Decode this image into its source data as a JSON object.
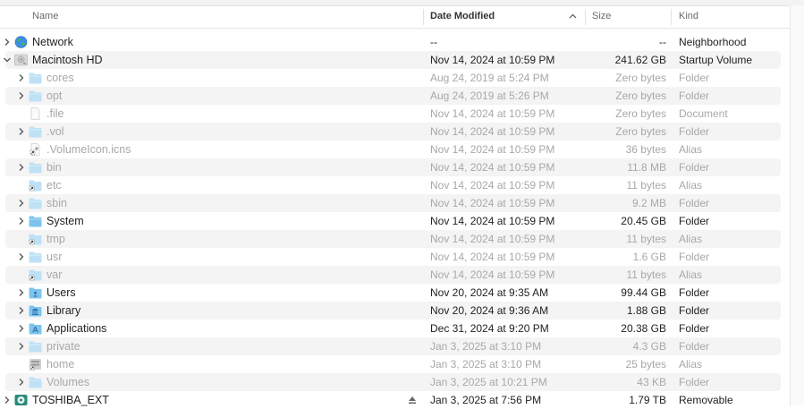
{
  "columns": {
    "name": "Name",
    "date": "Date Modified",
    "size": "Size",
    "kind": "Kind"
  },
  "rows": [
    {
      "level": 0,
      "disclosure": "collapsed",
      "icon": "network-globe-icon",
      "name": "Network",
      "date": "--",
      "size": "--",
      "kind": "Neighborhood",
      "dimmed": false,
      "stripe": false
    },
    {
      "level": 0,
      "disclosure": "expanded",
      "icon": "hard-drive-icon",
      "name": "Macintosh HD",
      "date": "Nov 14, 2024 at 10:59 PM",
      "size": "241.62 GB",
      "kind": "Startup Volume",
      "dimmed": false,
      "stripe": true
    },
    {
      "level": 1,
      "disclosure": "collapsed",
      "icon": "folder-icon",
      "name": "cores",
      "date": "Aug 24, 2019 at 5:24 PM",
      "size": "Zero bytes",
      "kind": "Folder",
      "dimmed": true,
      "stripe": false
    },
    {
      "level": 1,
      "disclosure": "collapsed",
      "icon": "folder-icon",
      "name": "opt",
      "date": "Aug 24, 2019 at 5:26 PM",
      "size": "Zero bytes",
      "kind": "Folder",
      "dimmed": true,
      "stripe": true
    },
    {
      "level": 1,
      "disclosure": "none",
      "icon": "document-icon",
      "name": ".file",
      "date": "Nov 14, 2024 at 10:59 PM",
      "size": "Zero bytes",
      "kind": "Document",
      "dimmed": true,
      "stripe": false
    },
    {
      "level": 1,
      "disclosure": "collapsed",
      "icon": "folder-icon",
      "name": ".vol",
      "date": "Nov 14, 2024 at 10:59 PM",
      "size": "Zero bytes",
      "kind": "Folder",
      "dimmed": true,
      "stripe": true
    },
    {
      "level": 1,
      "disclosure": "none",
      "icon": "alias-document-icon",
      "name": ".VolumeIcon.icns",
      "date": "Nov 14, 2024 at 10:59 PM",
      "size": "36 bytes",
      "kind": "Alias",
      "dimmed": true,
      "stripe": false
    },
    {
      "level": 1,
      "disclosure": "collapsed",
      "icon": "folder-icon",
      "name": "bin",
      "date": "Nov 14, 2024 at 10:59 PM",
      "size": "11.8 MB",
      "kind": "Folder",
      "dimmed": true,
      "stripe": true
    },
    {
      "level": 1,
      "disclosure": "none",
      "icon": "alias-folder-icon",
      "name": "etc",
      "date": "Nov 14, 2024 at 10:59 PM",
      "size": "11 bytes",
      "kind": "Alias",
      "dimmed": true,
      "stripe": false
    },
    {
      "level": 1,
      "disclosure": "collapsed",
      "icon": "folder-icon",
      "name": "sbin",
      "date": "Nov 14, 2024 at 10:59 PM",
      "size": "9.2 MB",
      "kind": "Folder",
      "dimmed": true,
      "stripe": true
    },
    {
      "level": 1,
      "disclosure": "collapsed",
      "icon": "folder-icon",
      "name": "System",
      "date": "Nov 14, 2024 at 10:59 PM",
      "size": "20.45 GB",
      "kind": "Folder",
      "dimmed": false,
      "stripe": false
    },
    {
      "level": 1,
      "disclosure": "none",
      "icon": "alias-folder-icon",
      "name": "tmp",
      "date": "Nov 14, 2024 at 10:59 PM",
      "size": "11 bytes",
      "kind": "Alias",
      "dimmed": true,
      "stripe": true
    },
    {
      "level": 1,
      "disclosure": "collapsed",
      "icon": "folder-icon",
      "name": "usr",
      "date": "Nov 14, 2024 at 10:59 PM",
      "size": "1.6 GB",
      "kind": "Folder",
      "dimmed": true,
      "stripe": false
    },
    {
      "level": 1,
      "disclosure": "none",
      "icon": "alias-folder-icon",
      "name": "var",
      "date": "Nov 14, 2024 at 10:59 PM",
      "size": "11 bytes",
      "kind": "Alias",
      "dimmed": true,
      "stripe": true
    },
    {
      "level": 1,
      "disclosure": "collapsed",
      "icon": "users-folder-icon",
      "name": "Users",
      "date": "Nov 20, 2024 at 9:35 AM",
      "size": "99.44 GB",
      "kind": "Folder",
      "dimmed": false,
      "stripe": false
    },
    {
      "level": 1,
      "disclosure": "collapsed",
      "icon": "library-folder-icon",
      "name": "Library",
      "date": "Nov 20, 2024 at 9:36 AM",
      "size": "1.88 GB",
      "kind": "Folder",
      "dimmed": false,
      "stripe": true
    },
    {
      "level": 1,
      "disclosure": "collapsed",
      "icon": "applications-folder-icon",
      "name": "Applications",
      "date": "Dec 31, 2024 at 9:20 PM",
      "size": "20.38 GB",
      "kind": "Folder",
      "dimmed": false,
      "stripe": false
    },
    {
      "level": 1,
      "disclosure": "collapsed",
      "icon": "folder-icon",
      "name": "private",
      "date": "Jan 3, 2025 at 3:10 PM",
      "size": "4.3 GB",
      "kind": "Folder",
      "dimmed": true,
      "stripe": true
    },
    {
      "level": 1,
      "disclosure": "none",
      "icon": "alias-server-icon",
      "name": "home",
      "date": "Jan 3, 2025 at 3:10 PM",
      "size": "25 bytes",
      "kind": "Alias",
      "dimmed": true,
      "stripe": false
    },
    {
      "level": 1,
      "disclosure": "collapsed",
      "icon": "folder-icon",
      "name": "Volumes",
      "date": "Jan 3, 2025 at 10:21 PM",
      "size": "43 KB",
      "kind": "Folder",
      "dimmed": true,
      "stripe": true
    },
    {
      "level": 0,
      "disclosure": "collapsed",
      "icon": "external-drive-icon",
      "name": "TOSHIBA_EXT",
      "date": "Jan 3, 2025 at 7:56 PM",
      "size": "1.79 TB",
      "kind": "Removable",
      "dimmed": false,
      "stripe": false,
      "eject": true
    }
  ],
  "colors": {
    "folder": "#7cc4ee",
    "folder_dim": "#bfe1f5",
    "stripe": "#f4f4f5",
    "accent": "#1f7ae0"
  }
}
